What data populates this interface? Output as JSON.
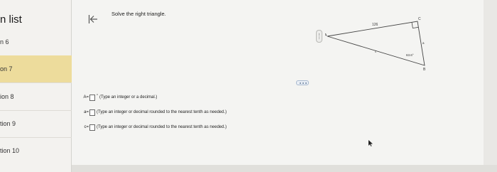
{
  "sidebar": {
    "title": "n list",
    "items": [
      {
        "label": "n 6"
      },
      {
        "label": "on 7"
      },
      {
        "label": "ion 8"
      },
      {
        "label": "tion 9"
      },
      {
        "label": "tion 10"
      }
    ],
    "active_index": 1
  },
  "question": {
    "prompt": "Solve the right triangle."
  },
  "figure": {
    "side_label": "126",
    "vertex_a": "A",
    "vertex_b": "B",
    "vertex_c": "C",
    "side_a": "a",
    "side_c": "c",
    "angle_label": "63.6°"
  },
  "answers": [
    {
      "label": "A=",
      "sup": "°",
      "hint": "(Type an integer or a decimal.)"
    },
    {
      "label": "a=",
      "sup": "",
      "hint": "(Type an integer or decimal rounded to the nearest tenth as needed.)"
    },
    {
      "label": "c=",
      "sup": "",
      "hint": "(Type an integer or decimal rounded to the nearest tenth as needed.)"
    }
  ],
  "colors": {
    "active_item": "#eddc9c",
    "background": "#f4f4f2"
  }
}
